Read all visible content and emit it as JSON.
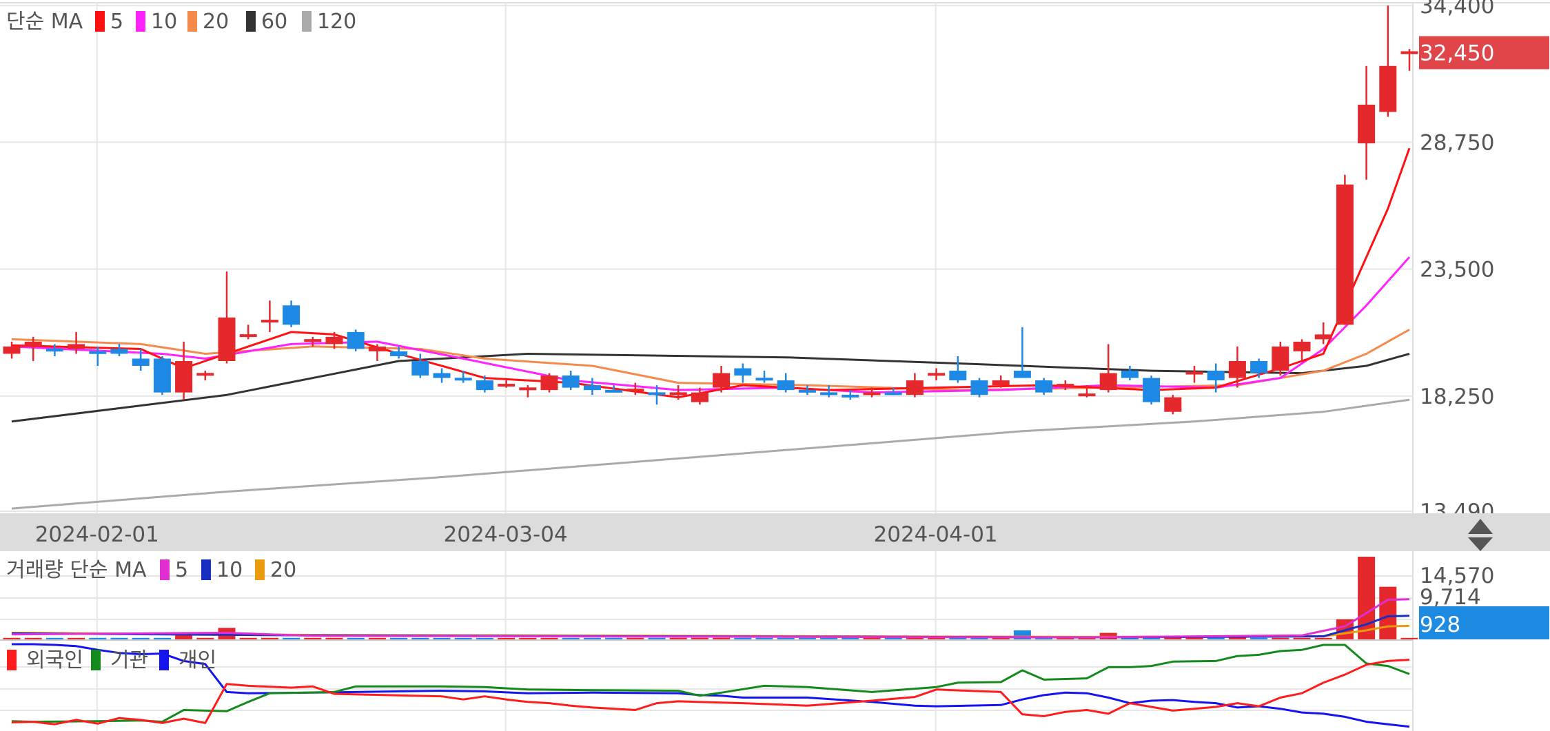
{
  "chart_data": {
    "type": "candlestick",
    "price_axis": {
      "min": 13490,
      "max": 34400,
      "ticks": [
        "34,400",
        "28,750",
        "23,500",
        "18,250",
        "13,490"
      ]
    },
    "x_ticks": [
      {
        "label": "2024-02-01",
        "index": 4
      },
      {
        "label": "2024-03-04",
        "index": 23
      },
      {
        "label": "2024-04-01",
        "index": 43
      }
    ],
    "current_price": {
      "label": "32,450",
      "value": 32450
    },
    "price_legend": {
      "title": "단순 MA",
      "items": [
        {
          "label": "5",
          "color": "#ff1111"
        },
        {
          "label": "10",
          "color": "#ff22ff"
        },
        {
          "label": "20",
          "color": "#f58a4c"
        },
        {
          "label": "60",
          "color": "#333333"
        },
        {
          "label": "120",
          "color": "#aaaaaa"
        }
      ]
    },
    "colors": {
      "up": "#e4282c",
      "down": "#1e88e5",
      "tag": "#e0454a",
      "volume_tag": "#1e8be3"
    },
    "candles": [
      [
        20000,
        20500,
        19800,
        20300
      ],
      [
        20300,
        20700,
        19700,
        20500
      ],
      [
        20200,
        20400,
        19900,
        20100
      ],
      [
        20200,
        20900,
        20000,
        20400
      ],
      [
        20100,
        20300,
        19500,
        20000
      ],
      [
        20200,
        20400,
        19900,
        20000
      ],
      [
        19800,
        20200,
        19300,
        19500
      ],
      [
        19800,
        19900,
        18300,
        18400
      ],
      [
        18400,
        20500,
        18100,
        19700
      ],
      [
        19100,
        19300,
        18900,
        19200
      ],
      [
        19700,
        23400,
        19600,
        21500
      ],
      [
        20700,
        21200,
        20600,
        20800
      ],
      [
        21300,
        22200,
        20900,
        21400
      ],
      [
        22000,
        22200,
        21100,
        21200
      ],
      [
        20500,
        20700,
        20300,
        20600
      ],
      [
        20400,
        20900,
        20200,
        20700
      ],
      [
        20900,
        21000,
        20100,
        20200
      ],
      [
        20100,
        20400,
        19700,
        20300
      ],
      [
        20100,
        20300,
        19800,
        19900
      ],
      [
        19700,
        20000,
        19000,
        19100
      ],
      [
        19200,
        19400,
        18800,
        19000
      ],
      [
        19000,
        19300,
        18800,
        18900
      ],
      [
        18900,
        19100,
        18400,
        18500
      ],
      [
        18700,
        18900,
        18600,
        18700
      ],
      [
        18500,
        18700,
        18200,
        18600
      ],
      [
        18500,
        19200,
        18400,
        19100
      ],
      [
        19100,
        19300,
        18500,
        18600
      ],
      [
        18700,
        19000,
        18300,
        18500
      ],
      [
        18500,
        18700,
        18400,
        18400
      ],
      [
        18500,
        18800,
        18300,
        18500
      ],
      [
        18400,
        18700,
        17900,
        18300
      ],
      [
        18300,
        18700,
        18100,
        18400
      ],
      [
        18000,
        18600,
        17900,
        18400
      ],
      [
        18600,
        19500,
        18400,
        19200
      ],
      [
        19400,
        19600,
        18800,
        19100
      ],
      [
        19000,
        19300,
        18800,
        18900
      ],
      [
        18900,
        19200,
        18400,
        18500
      ],
      [
        18500,
        18700,
        18300,
        18400
      ],
      [
        18400,
        18700,
        18200,
        18300
      ],
      [
        18300,
        18500,
        18100,
        18200
      ],
      [
        18300,
        18600,
        18200,
        18400
      ],
      [
        18400,
        18600,
        18300,
        18300
      ],
      [
        18300,
        19200,
        18200,
        18900
      ],
      [
        19100,
        19400,
        18900,
        19200
      ],
      [
        19300,
        19900,
        18800,
        18900
      ],
      [
        18900,
        19000,
        18200,
        18300
      ],
      [
        18700,
        19100,
        18600,
        18900
      ],
      [
        19300,
        21100,
        19300,
        19000
      ],
      [
        18900,
        19000,
        18300,
        18400
      ],
      [
        18700,
        18900,
        18500,
        18700
      ],
      [
        18300,
        18700,
        18200,
        18300
      ],
      [
        18500,
        20400,
        18400,
        19200
      ],
      [
        19300,
        19500,
        18900,
        19000
      ],
      [
        19000,
        19100,
        17900,
        18000
      ],
      [
        17600,
        18300,
        17500,
        18200
      ],
      [
        19200,
        19500,
        18800,
        19200
      ],
      [
        19300,
        19600,
        18400,
        18900
      ],
      [
        19000,
        20300,
        18600,
        19700
      ],
      [
        19700,
        19800,
        19000,
        19200
      ],
      [
        19300,
        20500,
        19100,
        20300
      ],
      [
        20100,
        20600,
        19700,
        20500
      ],
      [
        20600,
        21300,
        20400,
        20800
      ],
      [
        21200,
        27400,
        21200,
        27000
      ],
      [
        28700,
        31900,
        27200,
        30300
      ],
      [
        30000,
        34400,
        29800,
        31900
      ],
      [
        32450,
        32600,
        31700,
        32450
      ]
    ],
    "ma5": [
      [
        0,
        20350
      ],
      [
        6,
        20200
      ],
      [
        8,
        19400
      ],
      [
        10,
        20000
      ],
      [
        13,
        20900
      ],
      [
        15,
        20800
      ],
      [
        18,
        20000
      ],
      [
        22,
        19000
      ],
      [
        26,
        18800
      ],
      [
        31,
        18200
      ],
      [
        34,
        18700
      ],
      [
        38,
        18500
      ],
      [
        43,
        18600
      ],
      [
        48,
        18700
      ],
      [
        53,
        18500
      ],
      [
        56,
        18600
      ],
      [
        59,
        19400
      ],
      [
        61,
        20000
      ],
      [
        64,
        26000
      ],
      [
        65,
        28500
      ]
    ],
    "ma10": [
      [
        0,
        20300
      ],
      [
        7,
        20000
      ],
      [
        9,
        19800
      ],
      [
        13,
        20400
      ],
      [
        17,
        20500
      ],
      [
        21,
        19800
      ],
      [
        26,
        18900
      ],
      [
        31,
        18500
      ],
      [
        36,
        18600
      ],
      [
        40,
        18400
      ],
      [
        46,
        18500
      ],
      [
        51,
        18700
      ],
      [
        56,
        18600
      ],
      [
        59,
        19000
      ],
      [
        61,
        20200
      ],
      [
        63,
        22000
      ],
      [
        65,
        24000
      ]
    ],
    "ma20": [
      [
        0,
        20600
      ],
      [
        6,
        20400
      ],
      [
        9,
        20000
      ],
      [
        14,
        20300
      ],
      [
        19,
        20200
      ],
      [
        22,
        19800
      ],
      [
        27,
        19500
      ],
      [
        31,
        18800
      ],
      [
        37,
        18700
      ],
      [
        44,
        18500
      ],
      [
        51,
        18600
      ],
      [
        57,
        18700
      ],
      [
        61,
        19300
      ],
      [
        63,
        20000
      ],
      [
        65,
        21000
      ]
    ],
    "ma60": [
      [
        0,
        17200
      ],
      [
        10,
        18300
      ],
      [
        18,
        19700
      ],
      [
        24,
        20000
      ],
      [
        28,
        19950
      ],
      [
        36,
        19850
      ],
      [
        44,
        19600
      ],
      [
        53,
        19300
      ],
      [
        60,
        19200
      ],
      [
        63,
        19500
      ],
      [
        65,
        20000
      ]
    ],
    "ma120": [
      [
        0,
        13600
      ],
      [
        10,
        14300
      ],
      [
        20,
        14900
      ],
      [
        30,
        15600
      ],
      [
        40,
        16300
      ],
      [
        47,
        16800
      ],
      [
        55,
        17200
      ],
      [
        61,
        17600
      ],
      [
        65,
        18100
      ]
    ],
    "volume_panel": {
      "legend_title": "거래량 단순 MA",
      "legend_items": [
        {
          "label": "5",
          "color": "#e02fd0"
        },
        {
          "label": "10",
          "color": "#1a2fc2"
        },
        {
          "label": "20",
          "color": "#eb9c0e"
        }
      ],
      "axis_ticks": [
        "14,570",
        "9,714"
      ],
      "current_volume": "928",
      "max": 16500,
      "spikes": [
        [
          8,
          900
        ],
        [
          10,
          2300
        ],
        [
          47,
          1800
        ],
        [
          51,
          1300
        ],
        [
          57,
          600
        ],
        [
          62,
          4000
        ],
        [
          63,
          16500
        ],
        [
          64,
          10500
        ]
      ],
      "base_volume": 300,
      "ma5": [
        [
          0,
          1000
        ],
        [
          10,
          1300
        ],
        [
          14,
          700
        ],
        [
          50,
          400
        ],
        [
          60,
          800
        ],
        [
          62,
          2600
        ],
        [
          64,
          7900
        ],
        [
          65,
          8000
        ]
      ],
      "ma10": [
        [
          0,
          1200
        ],
        [
          14,
          800
        ],
        [
          50,
          400
        ],
        [
          61,
          600
        ],
        [
          63,
          3000
        ],
        [
          64,
          4600
        ],
        [
          65,
          4700
        ]
      ],
      "ma20": [
        [
          0,
          1300
        ],
        [
          14,
          900
        ],
        [
          50,
          500
        ],
        [
          61,
          600
        ],
        [
          63,
          1800
        ],
        [
          64,
          2600
        ],
        [
          65,
          2700
        ]
      ]
    },
    "investor_panel": {
      "legend_items": [
        {
          "label": "외국인",
          "color": "#ff1c1c"
        },
        {
          "label": "기관",
          "color": "#14891c"
        },
        {
          "label": "개인",
          "color": "#1414f0"
        }
      ],
      "foreign": [
        [
          0,
          0.05
        ],
        [
          1,
          0.06
        ],
        [
          2,
          0.02
        ],
        [
          3,
          0.09
        ],
        [
          4,
          0.03
        ],
        [
          5,
          0.12
        ],
        [
          6,
          0.09
        ],
        [
          7,
          0.04
        ],
        [
          8,
          0.11
        ],
        [
          9,
          0.04
        ],
        [
          10,
          0.67
        ],
        [
          11,
          0.64
        ],
        [
          13,
          0.61
        ],
        [
          14,
          0.63
        ],
        [
          15,
          0.51
        ],
        [
          20,
          0.47
        ],
        [
          21,
          0.42
        ],
        [
          22,
          0.47
        ],
        [
          23,
          0.42
        ],
        [
          24,
          0.38
        ],
        [
          25,
          0.36
        ],
        [
          26,
          0.32
        ],
        [
          27,
          0.29
        ],
        [
          29,
          0.25
        ],
        [
          30,
          0.36
        ],
        [
          31,
          0.39
        ],
        [
          34,
          0.36
        ],
        [
          37,
          0.32
        ],
        [
          40,
          0.4
        ],
        [
          42,
          0.46
        ],
        [
          43,
          0.58
        ],
        [
          46,
          0.54
        ],
        [
          47,
          0.18
        ],
        [
          48,
          0.15
        ],
        [
          49,
          0.22
        ],
        [
          50,
          0.25
        ],
        [
          51,
          0.19
        ],
        [
          52,
          0.36
        ],
        [
          54,
          0.24
        ],
        [
          56,
          0.3
        ],
        [
          57,
          0.36
        ],
        [
          58,
          0.31
        ],
        [
          59,
          0.45
        ],
        [
          60,
          0.52
        ],
        [
          61,
          0.69
        ],
        [
          62,
          0.82
        ],
        [
          63,
          0.98
        ],
        [
          64,
          1.04
        ],
        [
          65,
          1.06
        ]
      ],
      "institution": [
        [
          0,
          0.07
        ],
        [
          1,
          0.06
        ],
        [
          4,
          0.07
        ],
        [
          6,
          0.08
        ],
        [
          7,
          0.06
        ],
        [
          8,
          0.25
        ],
        [
          9,
          0.24
        ],
        [
          10,
          0.23
        ],
        [
          11,
          0.38
        ],
        [
          12,
          0.52
        ],
        [
          15,
          0.54
        ],
        [
          16,
          0.63
        ],
        [
          20,
          0.63
        ],
        [
          22,
          0.62
        ],
        [
          24,
          0.58
        ],
        [
          27,
          0.57
        ],
        [
          31,
          0.56
        ],
        [
          32,
          0.48
        ],
        [
          33,
          0.53
        ],
        [
          35,
          0.64
        ],
        [
          37,
          0.62
        ],
        [
          40,
          0.54
        ],
        [
          43,
          0.62
        ],
        [
          44,
          0.69
        ],
        [
          46,
          0.7
        ],
        [
          47,
          0.89
        ],
        [
          48,
          0.74
        ],
        [
          50,
          0.76
        ],
        [
          51,
          0.94
        ],
        [
          52,
          0.94
        ],
        [
          53,
          0.96
        ],
        [
          54,
          1.03
        ],
        [
          56,
          1.04
        ],
        [
          57,
          1.12
        ],
        [
          58,
          1.14
        ],
        [
          59,
          1.2
        ],
        [
          60,
          1.22
        ],
        [
          61,
          1.3
        ],
        [
          62,
          1.3
        ],
        [
          63,
          1.0
        ],
        [
          64,
          0.96
        ],
        [
          65,
          0.83
        ]
      ],
      "individual": [
        [
          0,
          1.41
        ],
        [
          1,
          1.32
        ],
        [
          2,
          1.3
        ],
        [
          3,
          1.28
        ],
        [
          4,
          1.22
        ],
        [
          5,
          1.17
        ],
        [
          6,
          1.15
        ],
        [
          7,
          1.16
        ],
        [
          8,
          1.04
        ],
        [
          9,
          0.99
        ],
        [
          10,
          0.54
        ],
        [
          11,
          0.52
        ],
        [
          14,
          0.53
        ],
        [
          16,
          0.54
        ],
        [
          20,
          0.56
        ],
        [
          22,
          0.55
        ],
        [
          24,
          0.52
        ],
        [
          27,
          0.53
        ],
        [
          31,
          0.52
        ],
        [
          32,
          0.49
        ],
        [
          33,
          0.48
        ],
        [
          34,
          0.45
        ],
        [
          37,
          0.45
        ],
        [
          40,
          0.38
        ],
        [
          42,
          0.32
        ],
        [
          43,
          0.31
        ],
        [
          46,
          0.33
        ],
        [
          47,
          0.42
        ],
        [
          48,
          0.49
        ],
        [
          49,
          0.53
        ],
        [
          50,
          0.52
        ],
        [
          51,
          0.45
        ],
        [
          52,
          0.36
        ],
        [
          53,
          0.4
        ],
        [
          54,
          0.41
        ],
        [
          55,
          0.38
        ],
        [
          56,
          0.36
        ],
        [
          57,
          0.29
        ],
        [
          58,
          0.31
        ],
        [
          59,
          0.27
        ],
        [
          60,
          0.21
        ],
        [
          61,
          0.19
        ],
        [
          62,
          0.14
        ],
        [
          63,
          0.06
        ],
        [
          64,
          0.02
        ],
        [
          65,
          -0.02
        ]
      ]
    }
  }
}
